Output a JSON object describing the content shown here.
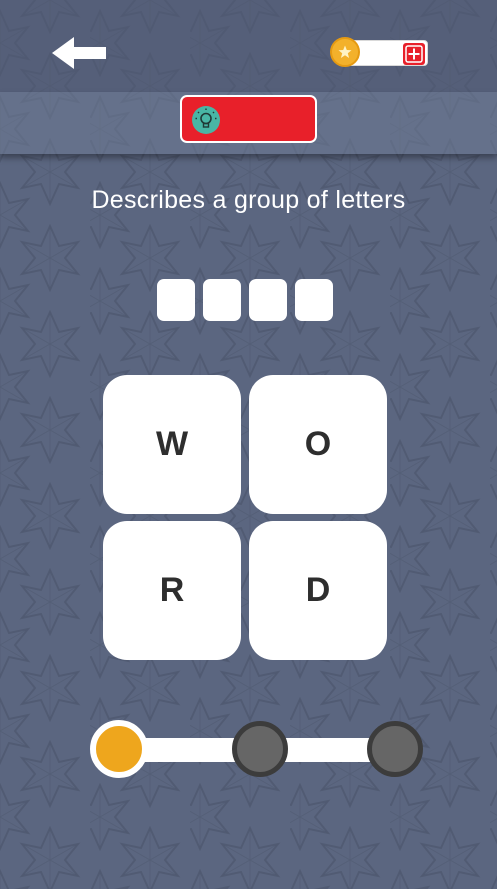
{
  "colors": {
    "background": "#5b6680",
    "accent_red": "#e8202a",
    "coin_gold": "#f3b12b",
    "bulb_teal": "#48b6a5",
    "progress_active": "#eea61d",
    "progress_inactive": "#666666"
  },
  "header": {
    "back_icon": "arrow-left-icon",
    "coins": {
      "icon": "star-coin-icon",
      "count": "",
      "add_icon": "plus-icon"
    }
  },
  "hint": {
    "icon": "lightbulb-icon",
    "label": ""
  },
  "puzzle": {
    "clue": "Describes a group of letters",
    "answer_slots": [
      "",
      "",
      "",
      ""
    ],
    "tiles": [
      "W",
      "O",
      "R",
      "D"
    ]
  },
  "progress": {
    "total_steps": 3,
    "current_step": 1
  }
}
